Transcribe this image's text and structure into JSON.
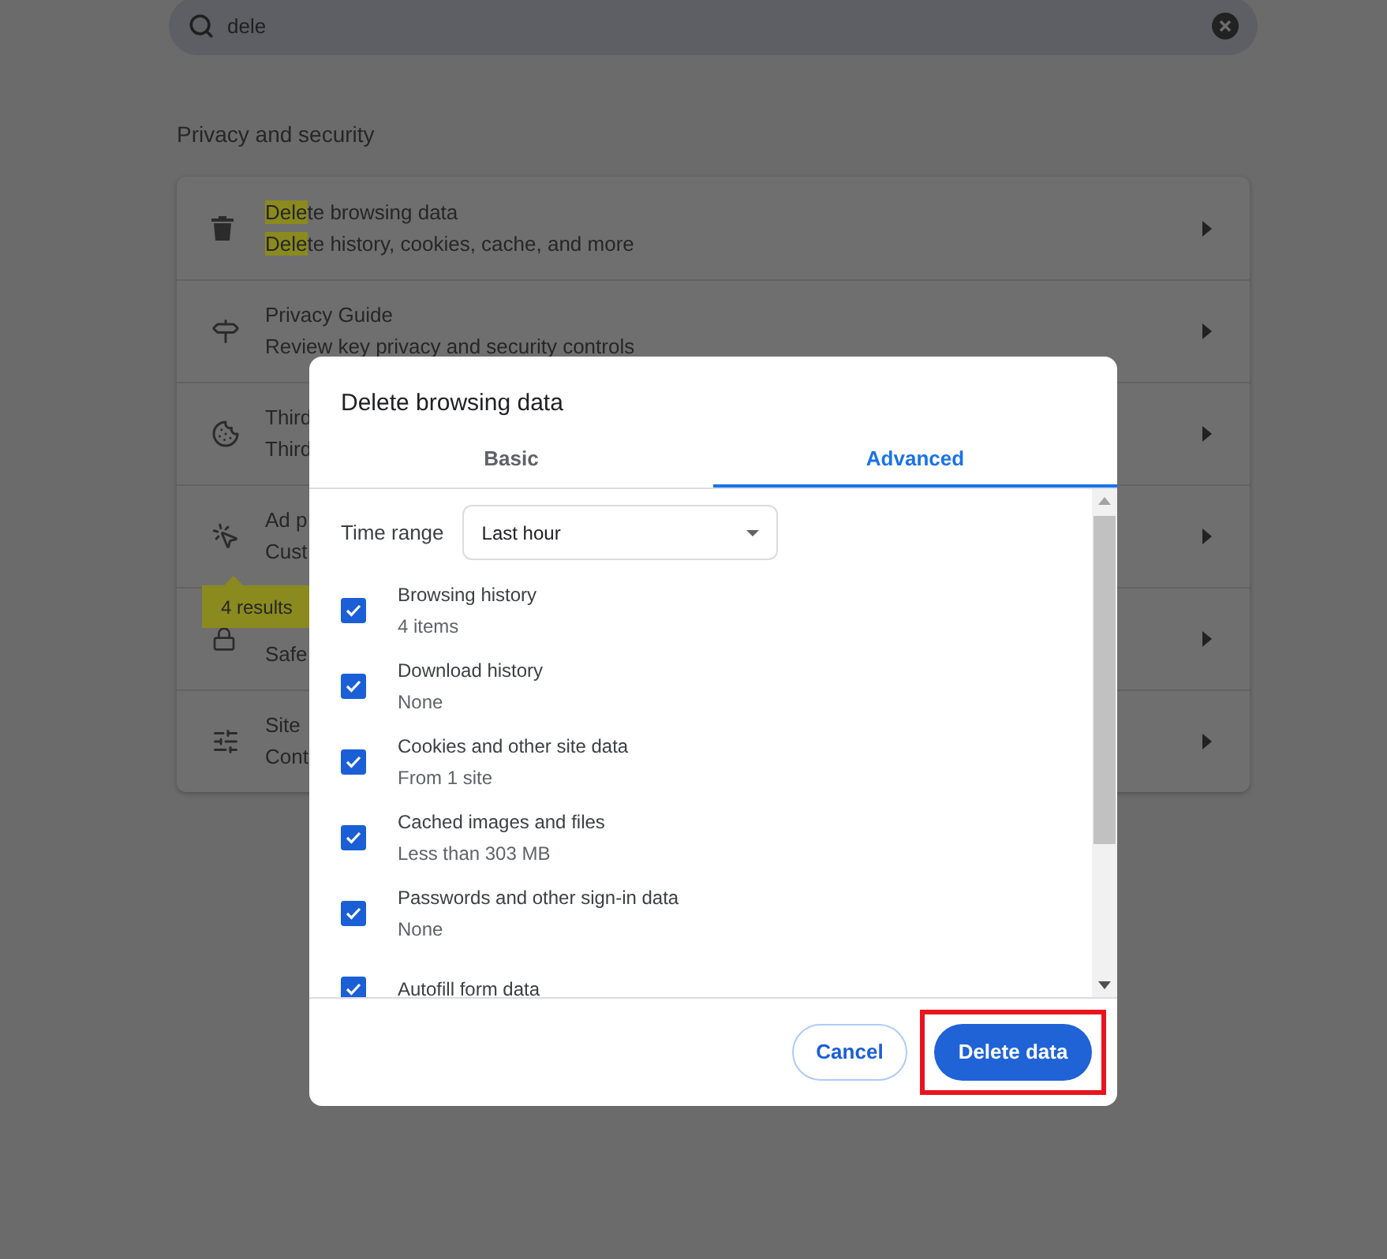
{
  "search": {
    "value": "dele"
  },
  "section_title": "Privacy and security",
  "settings_rows": [
    {
      "title": [
        {
          "text": "Dele",
          "highlighted": true
        },
        {
          "text": "te browsing data",
          "highlighted": false
        }
      ],
      "subtitle": [
        {
          "text": "Dele",
          "highlighted": true
        },
        {
          "text": "te history, cookies, cache, and more",
          "highlighted": false
        }
      ]
    },
    {
      "title": [
        {
          "text": "Privacy Guide",
          "highlighted": false
        }
      ],
      "subtitle": [
        {
          "text": "Review key privacy and security controls",
          "highlighted": false
        }
      ]
    },
    {
      "title": [
        {
          "text": "Third",
          "highlighted": false
        }
      ],
      "subtitle": [
        {
          "text": "Third",
          "highlighted": false
        }
      ]
    },
    {
      "title": [
        {
          "text": "Ad p",
          "highlighted": false
        }
      ],
      "subtitle": [
        {
          "text": "Cust",
          "highlighted": false
        }
      ]
    },
    {
      "title": [],
      "subtitle": [
        {
          "text": "Safe",
          "highlighted": false
        }
      ]
    },
    {
      "title": [
        {
          "text": "Site",
          "highlighted": false
        }
      ],
      "subtitle": [
        {
          "text": "Cont",
          "highlighted": false
        }
      ]
    }
  ],
  "results_bubble": "4 results",
  "dialog": {
    "title": "Delete browsing data",
    "tabs": [
      {
        "label": "Basic",
        "selected": false
      },
      {
        "label": "Advanced",
        "selected": true
      }
    ],
    "time_range": {
      "label": "Time range",
      "value": "Last hour"
    },
    "items": [
      {
        "label": "Browsing history",
        "detail": "4 items",
        "checked": true
      },
      {
        "label": "Download history",
        "detail": "None",
        "checked": true
      },
      {
        "label": "Cookies and other site data",
        "detail": "From 1 site",
        "checked": true
      },
      {
        "label": "Cached images and files",
        "detail": "Less than 303 MB",
        "checked": true
      },
      {
        "label": "Passwords and other sign-in data",
        "detail": "None",
        "checked": true
      },
      {
        "label": "Autofill form data",
        "checked": true
      }
    ],
    "buttons": [
      {
        "label": "Cancel",
        "kind": "secondary",
        "annotated": false
      },
      {
        "label": "Delete data",
        "kind": "primary",
        "annotated": true
      }
    ]
  }
}
